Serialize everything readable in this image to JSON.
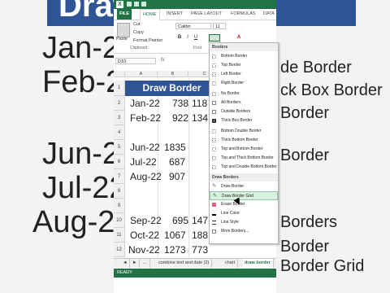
{
  "background": {
    "title": "Draw",
    "left_labels": [
      "Jan-22",
      "Feb-22",
      "Jun-22",
      "Jul-22",
      "Aug-22"
    ],
    "right_labels": [
      "de Border",
      "ck Box Border",
      "Border",
      "Border"
    ],
    "bottom_labels": [
      "Borders",
      "Border",
      "Border Grid"
    ]
  },
  "titlebar": {
    "app_icon": "X"
  },
  "ribbon_tabs": [
    "FILE",
    "HOME",
    "INSERT",
    "PAGE LAYOUT",
    "FORMULAS",
    "DATA"
  ],
  "clipboard": {
    "paste": "Paste",
    "cut": "Cut",
    "copy": "Copy",
    "format_painter": "Format Painter",
    "label": "Clipboard"
  },
  "font": {
    "name": "Calibri",
    "size": "11",
    "bold": "B",
    "italic": "I",
    "underline": "U",
    "color_a": "A",
    "label": "Font"
  },
  "formula_bar": {
    "name_box": "D10",
    "fx": "fx"
  },
  "columns": [
    "A",
    "B",
    "C"
  ],
  "rows": [
    "1",
    "2",
    "3",
    "4",
    "5",
    "6",
    "7",
    "8",
    "9",
    "10",
    "11",
    "12"
  ],
  "sheet": {
    "title": "Draw Border",
    "data": [
      {
        "r": "2",
        "a": "Jan-22",
        "b": "738",
        "c": "118"
      },
      {
        "r": "3",
        "a": "Feb-22",
        "b": "922",
        "c": "134"
      },
      {
        "r": "5",
        "a": "Jun-22",
        "b": "1835",
        "c": ""
      },
      {
        "r": "6",
        "a": "Jul-22",
        "b": "687",
        "c": ""
      },
      {
        "r": "7",
        "a": "Aug-22",
        "b": "907",
        "c": ""
      },
      {
        "r": "10",
        "a": "Sep-22",
        "b": "695",
        "c": "147"
      },
      {
        "r": "11",
        "a": "Oct-22",
        "b": "1067",
        "c": "188"
      },
      {
        "r": "12",
        "a": "Nov-22",
        "b": "1273",
        "c": "773"
      }
    ]
  },
  "sheet_tabs": [
    "combine text and date (2)",
    "chart",
    "draw border"
  ],
  "sheet_nav": [
    "◄",
    "►",
    "..."
  ],
  "status": "READY",
  "borders_menu": {
    "header": "Borders",
    "items": [
      "Bottom Border",
      "Top Border",
      "Left Border",
      "Right Border",
      "No Border",
      "All Borders",
      "Outside Borders",
      "Thick Box Border",
      "Bottom Double Border",
      "Thick Bottom Border",
      "Top and Bottom Border",
      "Top and Thick Bottom Border",
      "Top and Double Bottom Border"
    ],
    "draw_header": "Draw Borders",
    "draw_items": [
      "Draw Border",
      "Draw Border Grid",
      "Erase Border",
      "Line Color",
      "Line Style",
      "More Borders..."
    ],
    "highlighted": "Draw Border Grid"
  },
  "colors": {
    "excel_green": "#217346",
    "title_blue": "#2f5597",
    "highlight": "#d9efe0"
  }
}
